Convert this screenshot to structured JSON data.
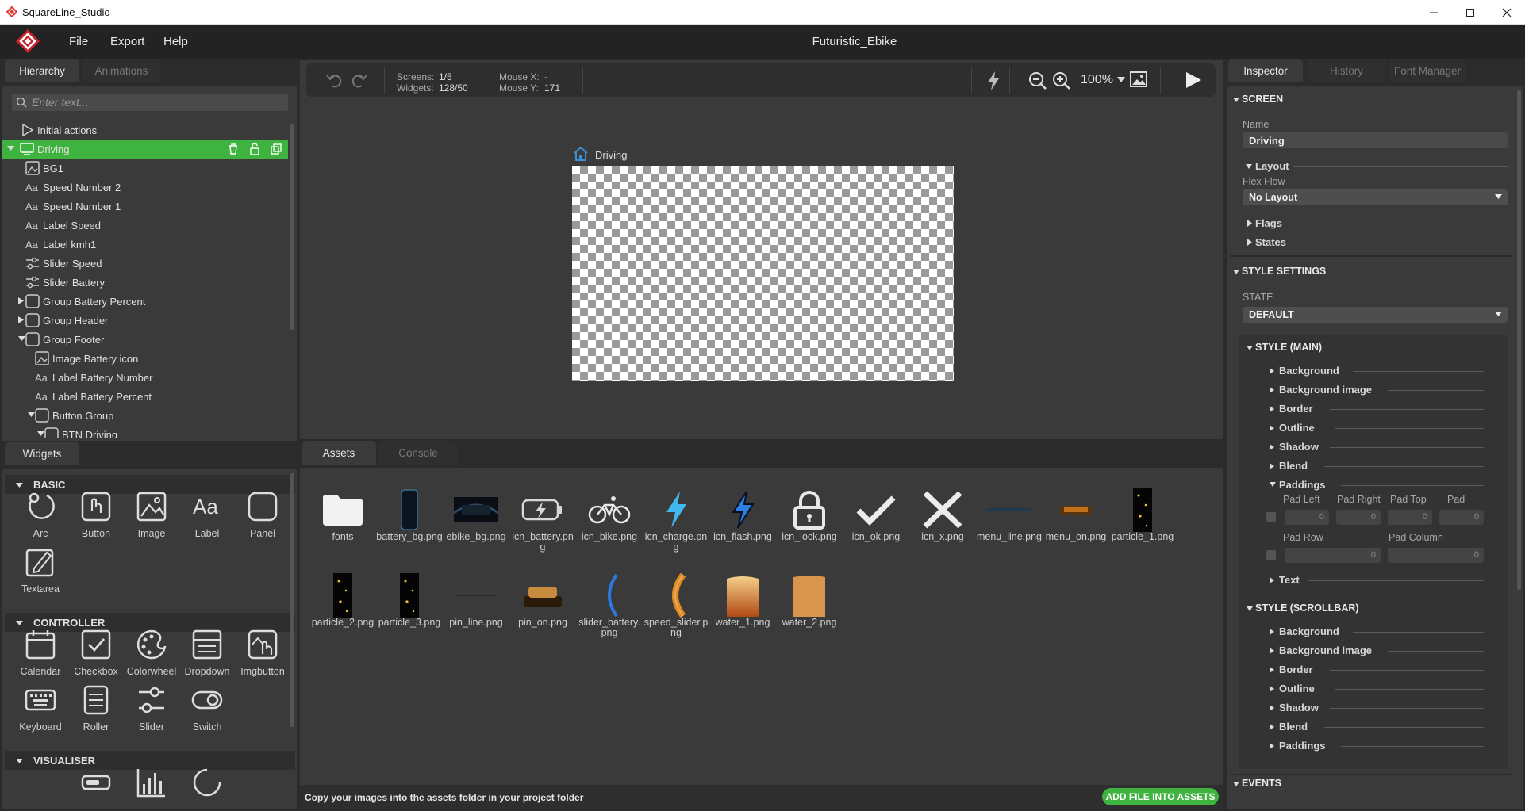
{
  "window": {
    "app_title": "SquareLine_Studio",
    "project_title": "Futuristic_Ebike",
    "accent_color": "#3fb33f"
  },
  "menu": {
    "items": [
      "File",
      "Export",
      "Help"
    ]
  },
  "hierarchy": {
    "tabs": [
      "Hierarchy",
      "Animations"
    ],
    "search_placeholder": "Enter text...",
    "items": [
      {
        "label": "Initial actions",
        "icon": "play-icon",
        "level": 0,
        "arrow": "none"
      },
      {
        "label": "Driving",
        "icon": "screen-icon",
        "level": 0,
        "arrow": "down",
        "selected": true
      },
      {
        "label": "BG1",
        "icon": "image-icon",
        "level": 1,
        "arrow": "none"
      },
      {
        "label": "Speed Number 2",
        "icon": "label-icon",
        "level": 1,
        "arrow": "none"
      },
      {
        "label": "Speed Number 1",
        "icon": "label-icon",
        "level": 1,
        "arrow": "none"
      },
      {
        "label": "Label Speed",
        "icon": "label-icon",
        "level": 1,
        "arrow": "none"
      },
      {
        "label": "Label kmh1",
        "icon": "label-icon",
        "level": 1,
        "arrow": "none"
      },
      {
        "label": "Slider Speed",
        "icon": "slider-icon",
        "level": 1,
        "arrow": "none"
      },
      {
        "label": "Slider Battery",
        "icon": "slider-icon",
        "level": 1,
        "arrow": "none"
      },
      {
        "label": "Group Battery Percent",
        "icon": "panel-icon",
        "level": 1,
        "arrow": "right"
      },
      {
        "label": "Group Header",
        "icon": "panel-icon",
        "level": 1,
        "arrow": "right"
      },
      {
        "label": "Group Footer",
        "icon": "panel-icon",
        "level": 1,
        "arrow": "down"
      },
      {
        "label": "Image Battery icon",
        "icon": "image-icon",
        "level": 2,
        "arrow": "none"
      },
      {
        "label": "Label Battery Number",
        "icon": "label-icon",
        "level": 2,
        "arrow": "none"
      },
      {
        "label": "Label Battery Percent",
        "icon": "label-icon",
        "level": 2,
        "arrow": "none"
      },
      {
        "label": "Button Group",
        "icon": "panel-icon",
        "level": 2,
        "arrow": "down"
      },
      {
        "label": "BTN Driving",
        "icon": "panel-icon",
        "level": 3,
        "arrow": "down"
      }
    ]
  },
  "widgets": {
    "tab": "Widgets",
    "sections": [
      {
        "title": "BASIC",
        "items": [
          {
            "label": "Arc",
            "icon": "arc-icon"
          },
          {
            "label": "Button",
            "icon": "button-icon"
          },
          {
            "label": "Image",
            "icon": "image-icon"
          },
          {
            "label": "Label",
            "icon": "label-icon"
          },
          {
            "label": "Panel",
            "icon": "panel-icon"
          },
          {
            "label": "Textarea",
            "icon": "textarea-icon"
          }
        ]
      },
      {
        "title": "CONTROLLER",
        "items": [
          {
            "label": "Calendar",
            "icon": "calendar-icon"
          },
          {
            "label": "Checkbox",
            "icon": "checkbox-icon"
          },
          {
            "label": "Colorwheel",
            "icon": "colorwheel-icon"
          },
          {
            "label": "Dropdown",
            "icon": "dropdown-icon"
          },
          {
            "label": "Imgbutton",
            "icon": "imgbutton-icon"
          },
          {
            "label": "Keyboard",
            "icon": "keyboard-icon"
          },
          {
            "label": "Roller",
            "icon": "roller-icon"
          },
          {
            "label": "Slider",
            "icon": "slider-icon"
          },
          {
            "label": "Switch",
            "icon": "switch-icon"
          }
        ]
      },
      {
        "title": "VISUALISER",
        "items": [
          {
            "label": "",
            "icon": "bar-icon"
          },
          {
            "label": "",
            "icon": "chart-icon"
          },
          {
            "label": "",
            "icon": "spinner-icon"
          }
        ]
      }
    ]
  },
  "toolbar": {
    "screens_label": "Screens:",
    "screens_value": "1/5",
    "widgets_label": "Widgets:",
    "widgets_value": "128/50",
    "mousex_label": "Mouse X:",
    "mousex_value": "-",
    "mousey_label": "Mouse Y:",
    "mousey_value": "171",
    "zoom": "100%"
  },
  "canvas": {
    "screen_label": "Driving"
  },
  "assets": {
    "tabs": [
      "Assets",
      "Console"
    ],
    "files": [
      {
        "name": "fonts",
        "thumb": "folder-icon"
      },
      {
        "name": "battery_bg.png",
        "thumb": "battery-bg-thumb"
      },
      {
        "name": "ebike_bg.png",
        "thumb": "ebike-bg-thumb"
      },
      {
        "name": "icn_battery.png",
        "thumb": "battery-charge-icon"
      },
      {
        "name": "icn_bike.png",
        "thumb": "bike-icon"
      },
      {
        "name": "icn_charge.png",
        "thumb": "lightning-icon"
      },
      {
        "name": "icn_flash.png",
        "thumb": "flash-icon"
      },
      {
        "name": "icn_lock.png",
        "thumb": "lock-icon"
      },
      {
        "name": "icn_ok.png",
        "thumb": "check-icon"
      },
      {
        "name": "icn_x.png",
        "thumb": "x-icon"
      },
      {
        "name": "menu_line.png",
        "thumb": "menu-line-thumb"
      },
      {
        "name": "menu_on.png",
        "thumb": "menu-on-thumb"
      },
      {
        "name": "particle_1.png",
        "thumb": "particle-thumb"
      },
      {
        "name": "particle_2.png",
        "thumb": "particle-thumb"
      },
      {
        "name": "particle_3.png",
        "thumb": "particle-thumb"
      },
      {
        "name": "pin_line.png",
        "thumb": "pin-line-thumb"
      },
      {
        "name": "pin_on.png",
        "thumb": "pin-on-thumb"
      },
      {
        "name": "slider_battery.png",
        "thumb": "slider-battery-thumb"
      },
      {
        "name": "speed_slider.png",
        "thumb": "speed-slider-thumb"
      },
      {
        "name": "water_1.png",
        "thumb": "water-thumb"
      },
      {
        "name": "water_2.png",
        "thumb": "water2-thumb"
      }
    ],
    "hint": "Copy your images into the assets folder in your project folder",
    "add_button": "ADD FILE INTO ASSETS"
  },
  "inspector": {
    "tabs": [
      "Inspector",
      "History",
      "Font Manager"
    ],
    "screen_section": "SCREEN",
    "name_label": "Name",
    "name_value": "Driving",
    "layout_label": "Layout",
    "flex_flow_label": "Flex Flow",
    "flex_flow_value": "No Layout",
    "flags_label": "Flags",
    "states_label": "States",
    "style_settings": "STYLE SETTINGS",
    "state_label": "STATE",
    "state_value": "DEFAULT",
    "style_main": "STYLE (MAIN)",
    "main_props": [
      "Background",
      "Background image",
      "Border",
      "Outline",
      "Shadow",
      "Blend",
      "Paddings"
    ],
    "pad_left": "Pad Left",
    "pad_right": "Pad Right",
    "pad_top": "Pad Top",
    "pad_bottom": "Pad",
    "pad_row": "Pad Row",
    "pad_column": "Pad Column",
    "zero": "0",
    "text_label": "Text",
    "style_scrollbar": "STYLE (SCROLLBAR)",
    "scroll_props": [
      "Background",
      "Background image",
      "Border",
      "Outline",
      "Shadow",
      "Blend",
      "Paddings"
    ],
    "events": "EVENTS"
  }
}
